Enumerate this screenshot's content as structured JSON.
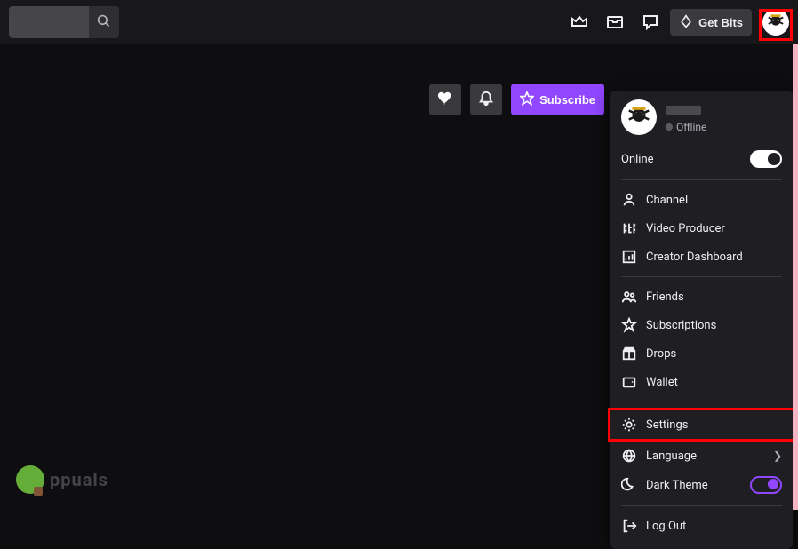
{
  "topbar": {
    "search_placeholder": "",
    "get_bits_label": "Get Bits"
  },
  "actions": {
    "subscribe_label": "Subscribe"
  },
  "user_menu": {
    "username": "",
    "status_label": "Offline",
    "online_toggle_label": "Online",
    "sections": {
      "channel": "Channel",
      "video_producer": "Video Producer",
      "creator_dashboard": "Creator Dashboard",
      "friends": "Friends",
      "subscriptions": "Subscriptions",
      "drops": "Drops",
      "wallet": "Wallet",
      "settings": "Settings",
      "language": "Language",
      "dark_theme": "Dark Theme",
      "log_out": "Log Out"
    }
  },
  "watermark": {
    "text": "ppuals"
  }
}
